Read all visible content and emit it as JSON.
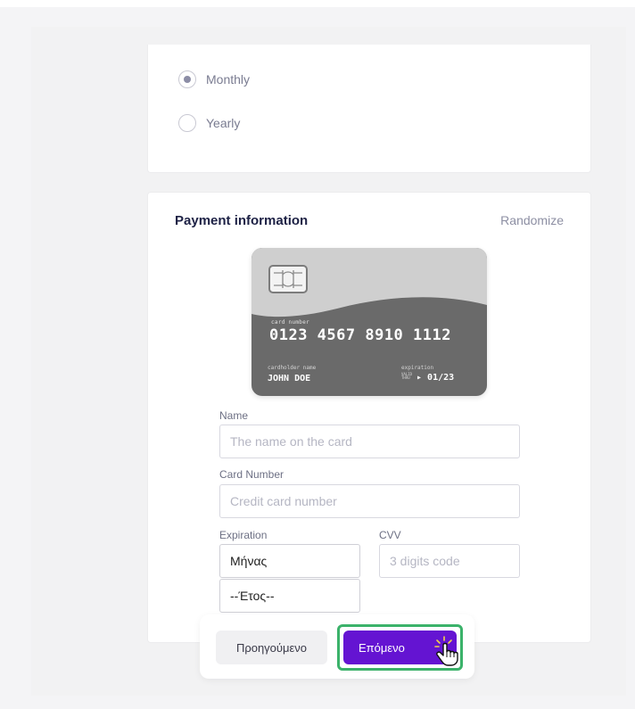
{
  "frequency": {
    "options": [
      {
        "label": "Monthly",
        "checked": true
      },
      {
        "label": "Yearly",
        "checked": false
      }
    ]
  },
  "payment": {
    "title": "Payment information",
    "randomize_label": "Randomize",
    "card": {
      "number_label": "card number",
      "number": "0123 4567 8910 1112",
      "holder_label": "cardholder name",
      "holder": "JOHN DOE",
      "expiration_label": "expiration",
      "valid_thru": "VALID THRU",
      "expiration": "01/23"
    },
    "fields": {
      "name_label": "Name",
      "name_placeholder": "The name on the card",
      "number_label": "Card Number",
      "number_placeholder": "Credit card number",
      "expiration_label": "Expiration",
      "month_value": "Μήνας",
      "year_value": "--Έτος--",
      "cvv_label": "CVV",
      "cvv_placeholder": "3 digits code"
    }
  },
  "nav": {
    "prev_label": "Προηγούμενο",
    "next_label": "Επόμενο"
  },
  "colors": {
    "accent": "#6414d2",
    "highlight": "#3bb26a",
    "card_body": "#6a6a6a"
  },
  "icons": [
    "sim-chip-icon",
    "pointer-hand-cursor-icon"
  ]
}
